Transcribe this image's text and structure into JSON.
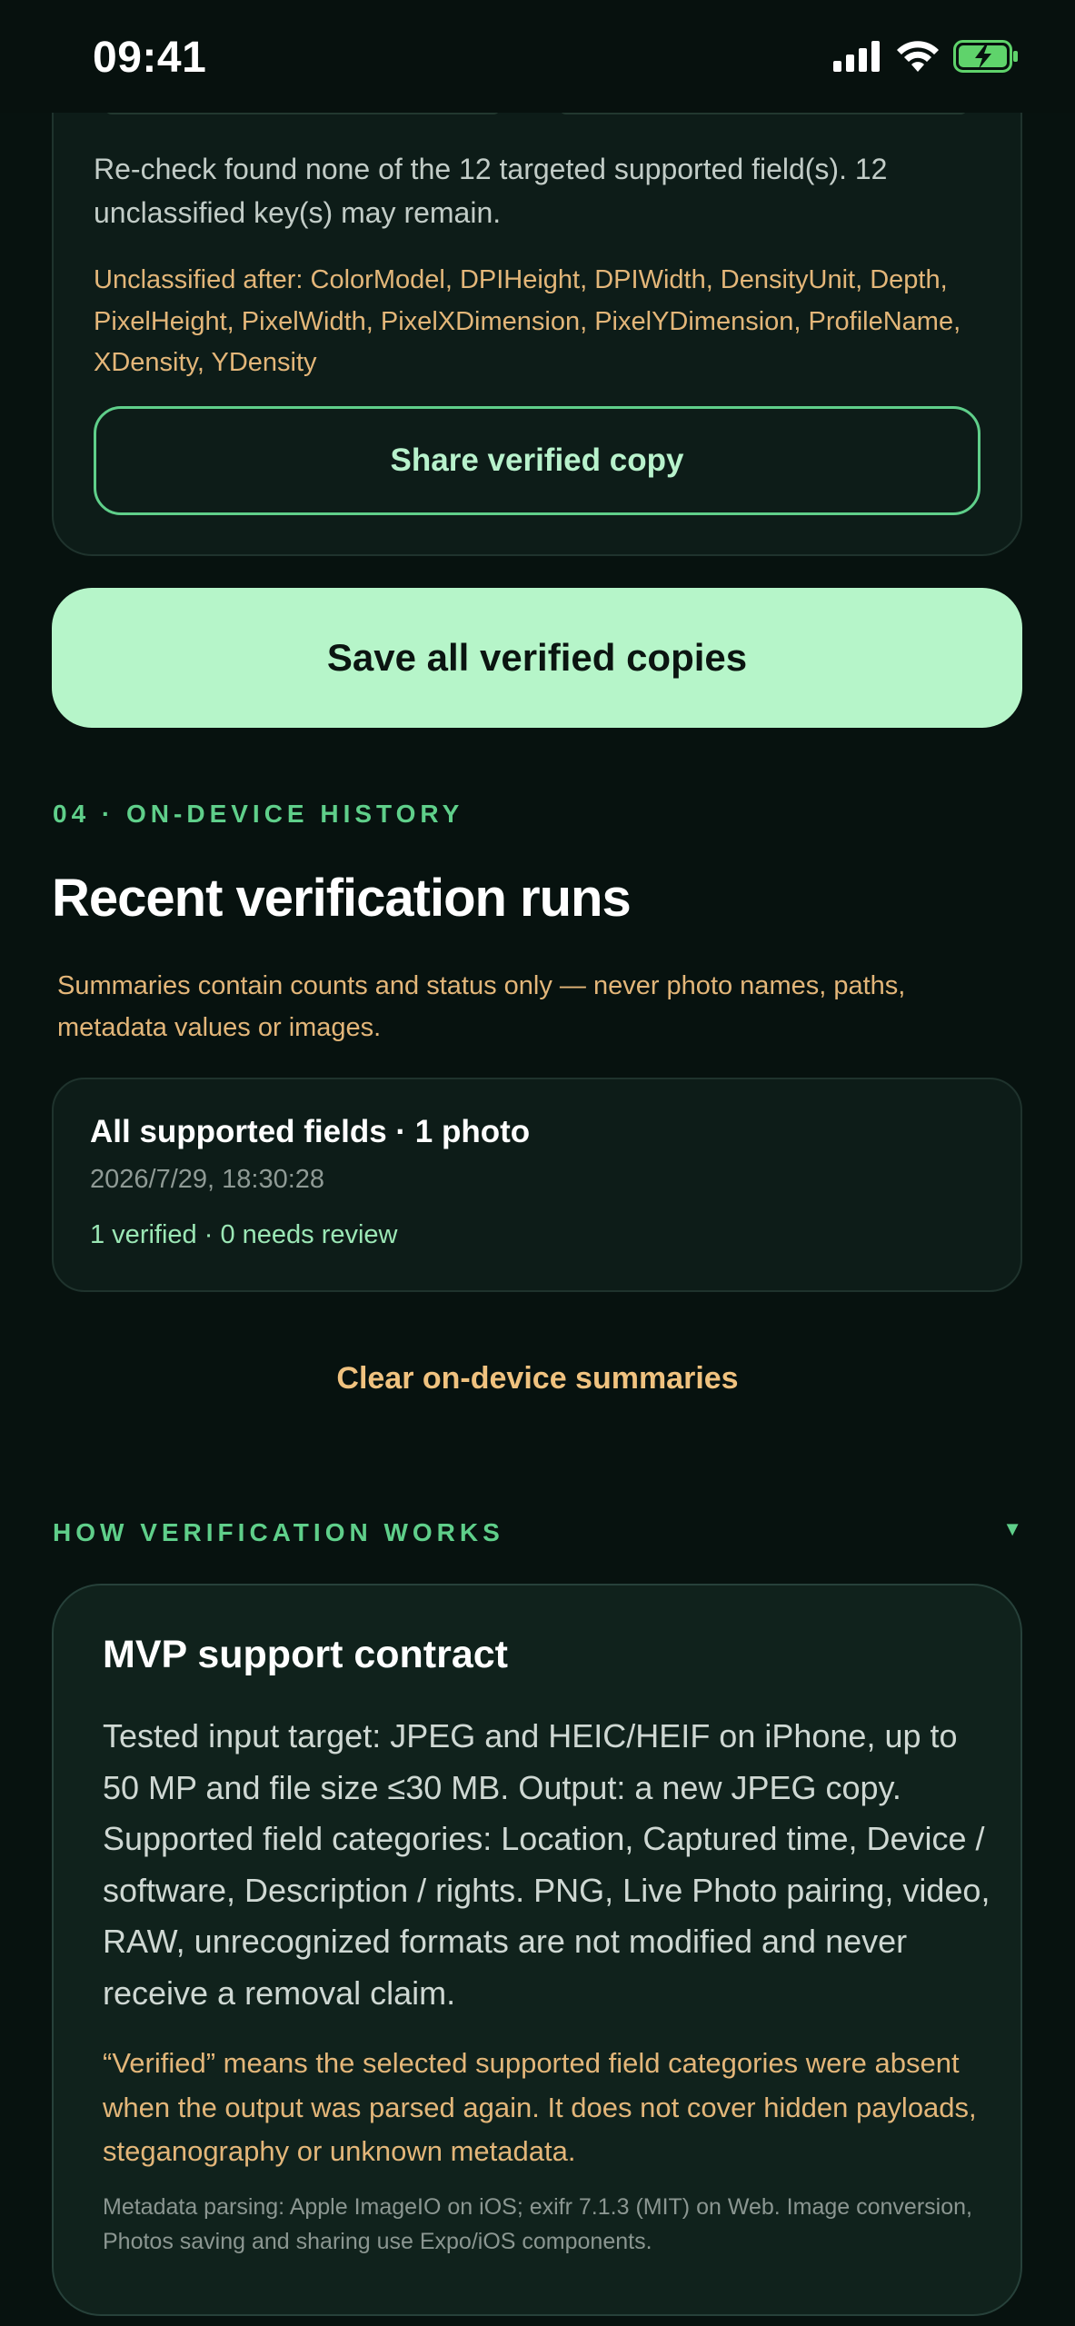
{
  "status_bar": {
    "time": "09:41"
  },
  "previous_card": {
    "recheck_text": "Re-check found none of the 12 targeted supported field(s). 12 unclassified key(s) may remain.",
    "unclassified_text": "Unclassified after: ColorModel, DPIHeight, DPIWidth, DensityUnit, Depth, PixelHeight, PixelWidth, PixelXDimension, PixelYDimension, ProfileName, XDensity, YDensity",
    "share_label": "Share verified copy"
  },
  "save_all_label": "Save all verified copies",
  "history": {
    "eyebrow": "04 · ON-DEVICE HISTORY",
    "title": "Recent verification runs",
    "description": "Summaries contain counts and status only — never photo names, paths, metadata values or images.",
    "run": {
      "title": "All supported fields · 1 photo",
      "date": "2026/7/29, 18:30:28",
      "status": "1 verified · 0 needs review"
    },
    "clear_label": "Clear on-device summaries"
  },
  "how_it_works": {
    "eyebrow": "HOW VERIFICATION WORKS",
    "toggle_glyph": "▼",
    "contract_title": "MVP support contract",
    "contract_body": "Tested input target: JPEG and HEIC/HEIF on iPhone, up to 50 MP and file size ≤30 MB. Output: a new JPEG copy. Supported field categories: Location, Captured time, Device / software, Description / rights. PNG, Live Photo pairing, video, RAW, unrecognized formats are not modified and never receive a removal claim.",
    "verified_note": "“Verified” means the selected supported field categories were absent when the output was parsed again. It does not cover hidden payloads, steganography or unknown metadata.",
    "footnote": "Metadata parsing: Apple ImageIO on iOS; exifr 7.1.3 (MIT) on Web. Image conversion, Photos saving and sharing use Expo/iOS components."
  },
  "colors": {
    "background": "#07120f",
    "accent_green": "#5fcf8a",
    "primary_button": "#b6f5c9",
    "warning_amber": "#e3b679"
  }
}
